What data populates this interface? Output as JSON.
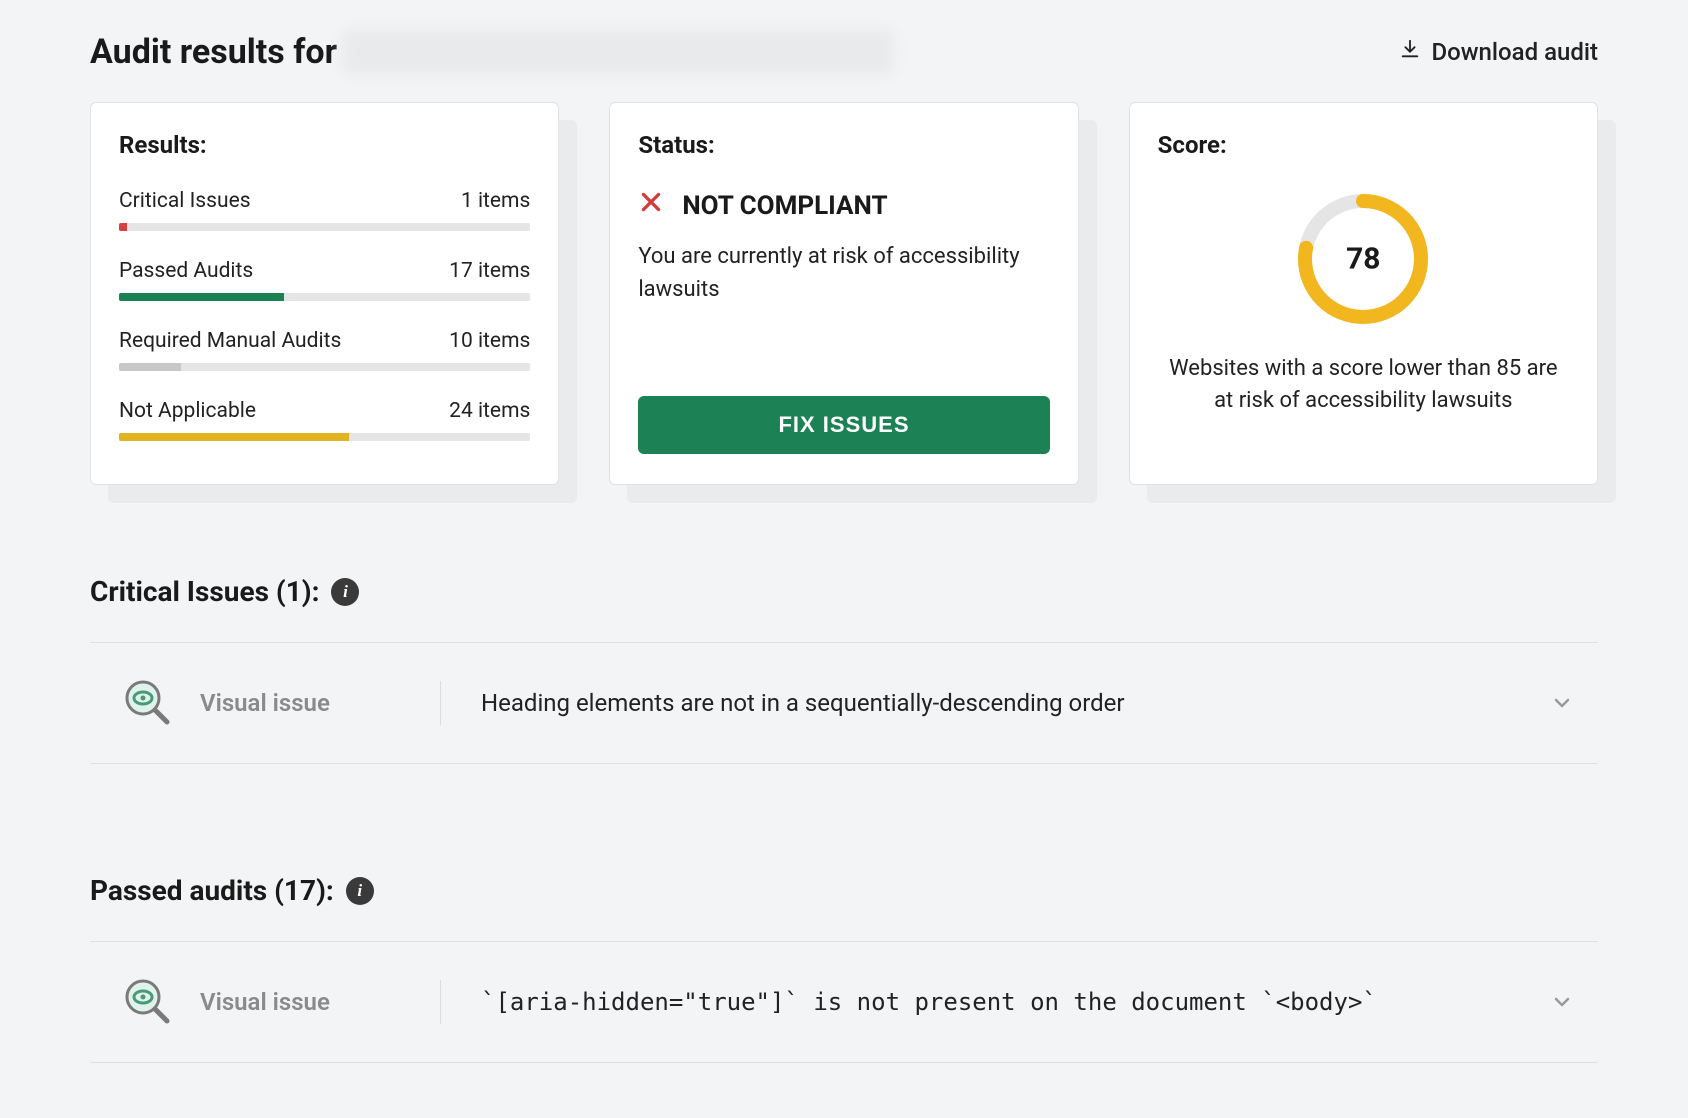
{
  "header": {
    "title_prefix": "Audit results for",
    "download_label": "Download audit"
  },
  "results_card": {
    "title": "Results:",
    "rows": [
      {
        "label": "Critical Issues",
        "count_text": "1 items",
        "fill_percent": 2,
        "color": "#d64040"
      },
      {
        "label": "Passed Audits",
        "count_text": "17 items",
        "fill_percent": 40,
        "color": "#1c8255"
      },
      {
        "label": "Required Manual Audits",
        "count_text": "10 items",
        "fill_percent": 15,
        "color": "#c8c8c8"
      },
      {
        "label": "Not Applicable",
        "count_text": "24 items",
        "fill_percent": 56,
        "color": "#e1b321"
      }
    ]
  },
  "status_card": {
    "title": "Status:",
    "status_text": "NOT COMPLIANT",
    "description": "You are currently at risk of accessibility lawsuits",
    "button_label": "FIX ISSUES"
  },
  "score_card": {
    "title": "Score:",
    "score": "78",
    "score_percent": 78,
    "ring_color": "#f2b71f",
    "description": "Websites with a score lower than 85 are at risk of accessibility lawsuits"
  },
  "sections": {
    "critical": {
      "title": "Critical Issues (1):",
      "items": [
        {
          "type": "Visual issue",
          "desc_html": "Heading elements are not in a sequentially-descending order"
        }
      ]
    },
    "passed": {
      "title": "Passed audits (17):",
      "items": [
        {
          "type": "Visual issue",
          "desc_html": "`[aria-hidden=\"true\"]` is not present on the document `<body>`"
        }
      ]
    }
  }
}
